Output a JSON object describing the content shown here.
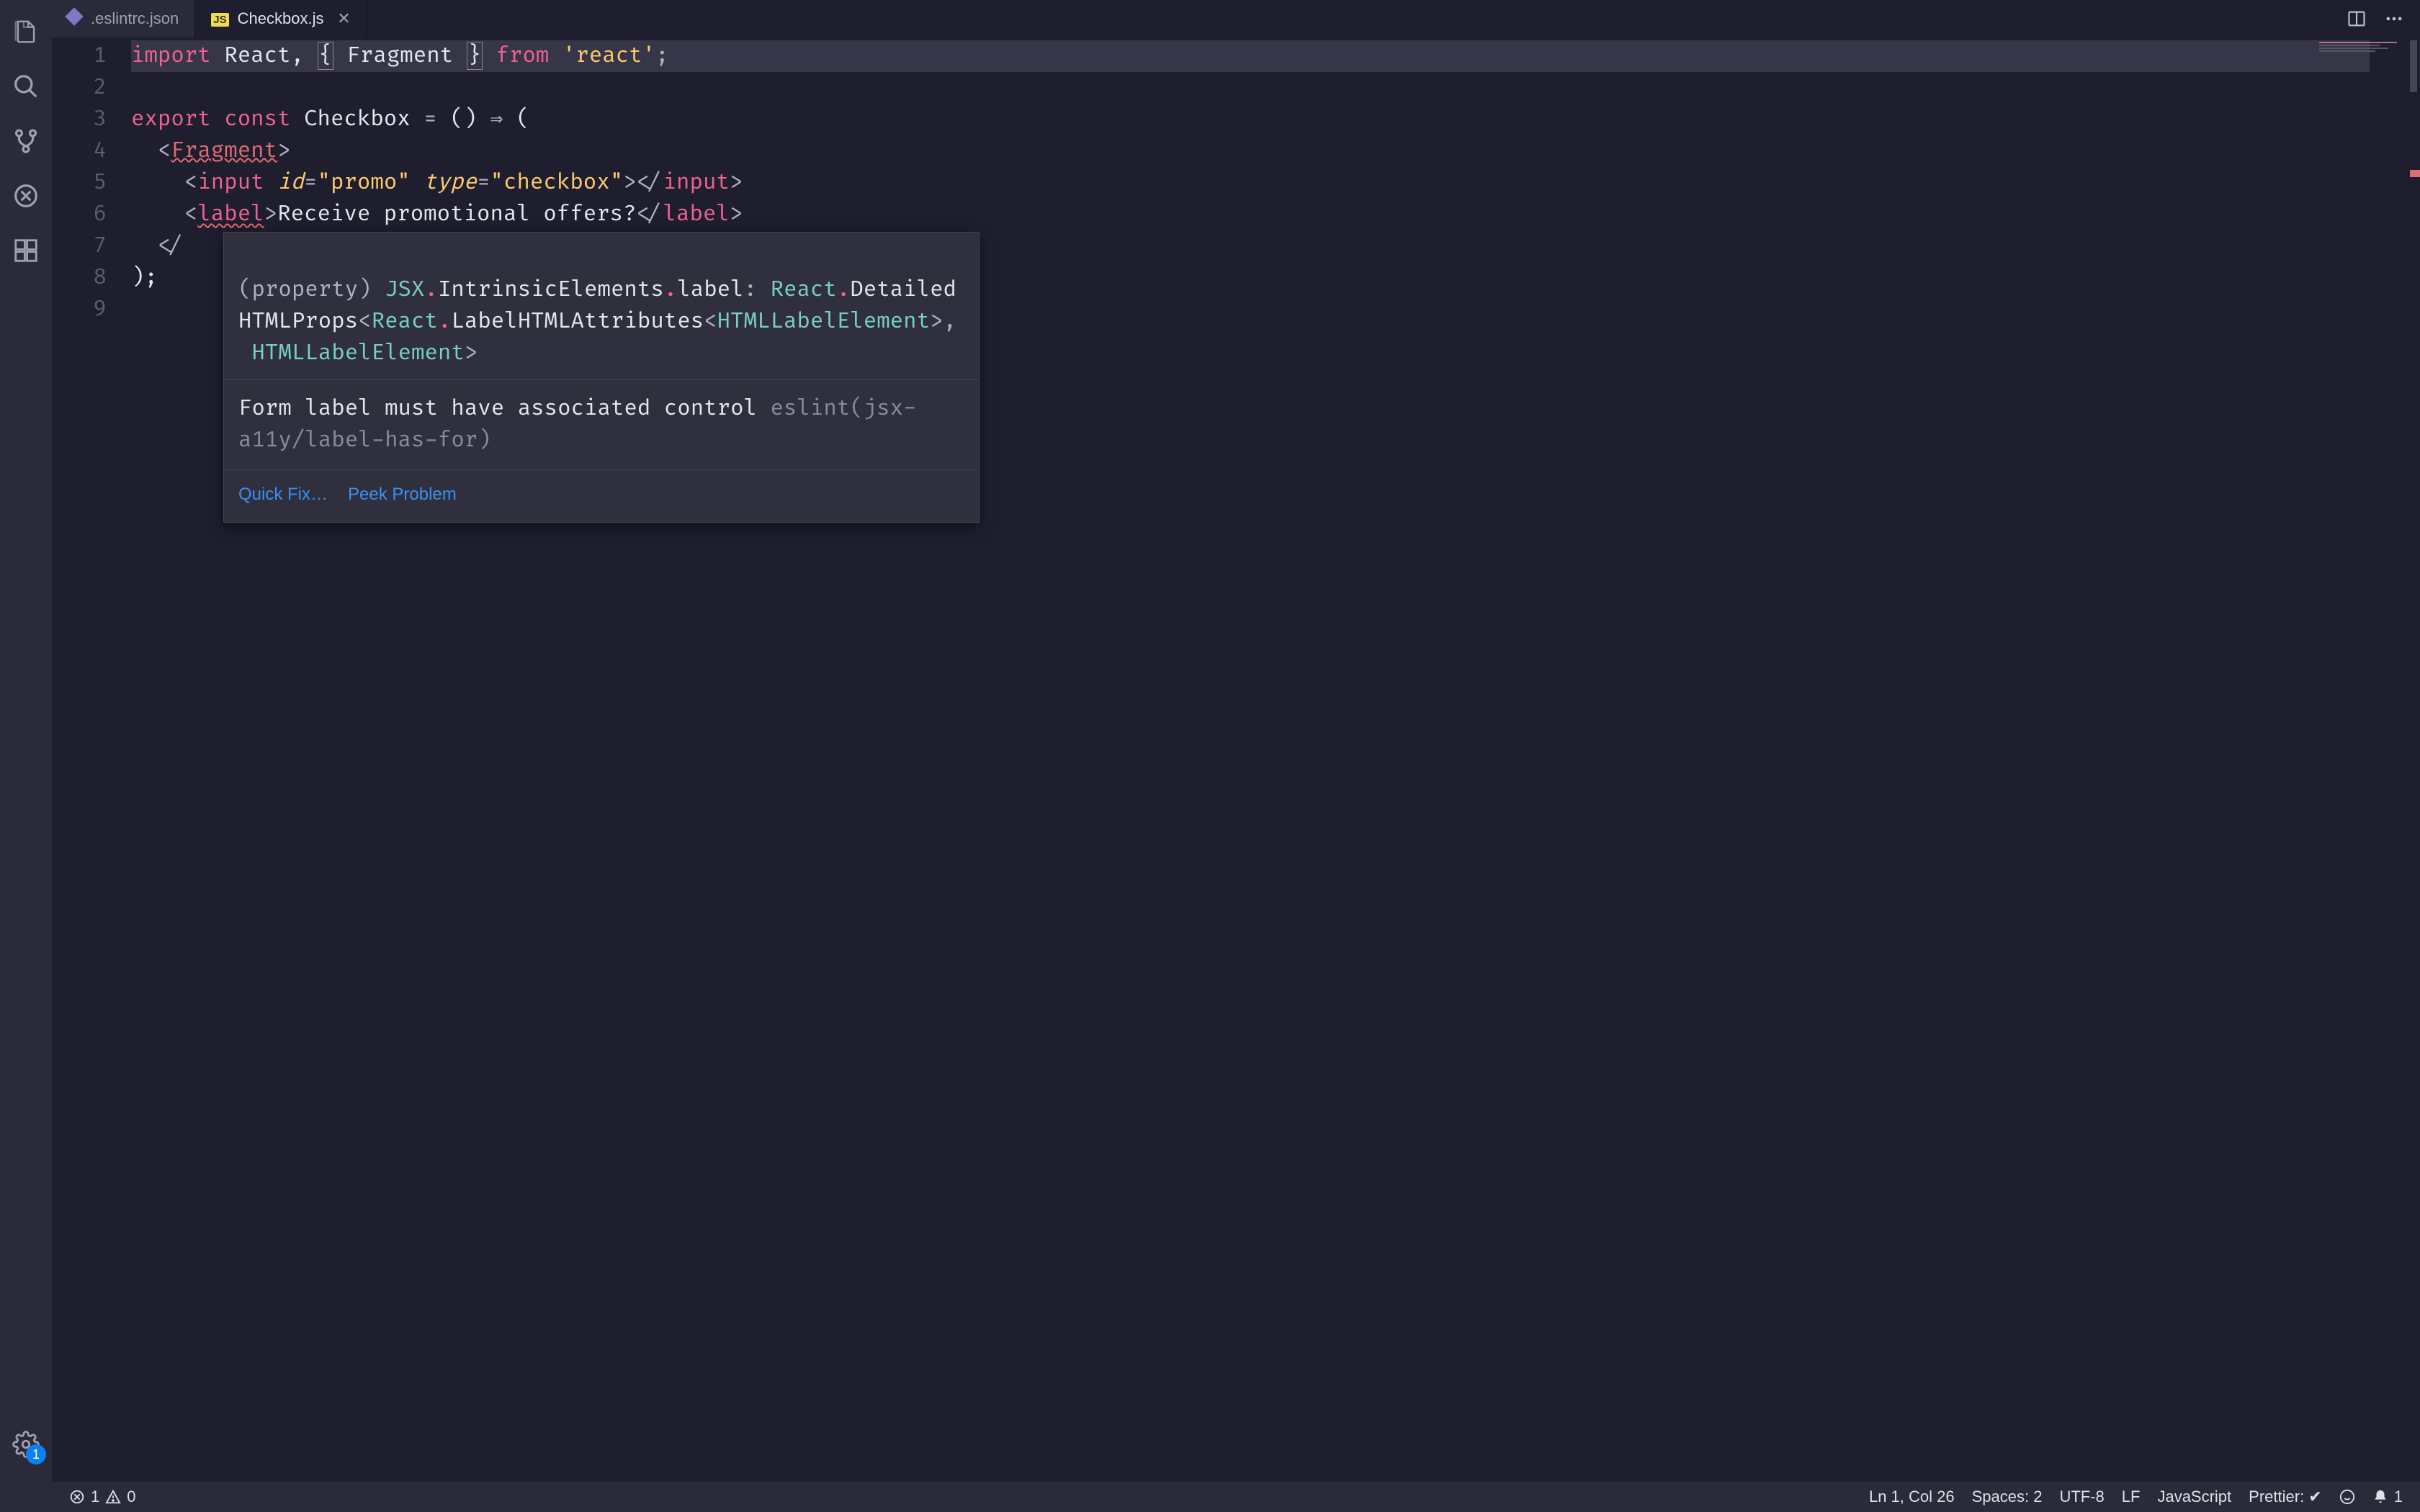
{
  "tabs": [
    {
      "label": ".eslintrc.json",
      "icon": "eslint",
      "active": false,
      "dirty": false
    },
    {
      "label": "Checkbox.js",
      "icon": "js",
      "active": true,
      "dirty": false
    }
  ],
  "gutter": {
    "lines": [
      "1",
      "2",
      "3",
      "4",
      "5",
      "6",
      "7",
      "8",
      "9"
    ]
  },
  "code": {
    "l1": {
      "a": "import",
      "b": " React",
      "c": ", ",
      "d": "{",
      "e": " Fragment ",
      "f": "}",
      "g": " ",
      "h": "from",
      "i": " ",
      "j": "'react'",
      "k": ";"
    },
    "l3": {
      "a": "export",
      "b": " ",
      "c": "const",
      "d": " Checkbox ",
      "e": "=",
      "f": " () ",
      "g": "⇒",
      "h": " ("
    },
    "l4": {
      "a": "<",
      "b": "Fragment",
      "c": ">"
    },
    "l5": {
      "a": "<",
      "b": "input",
      "c": " ",
      "d": "id",
      "e": "=",
      "f": "\"promo\"",
      "g": " ",
      "h": "type",
      "i": "=",
      "j": "\"checkbox\"",
      "k": ">",
      "l": "</",
      "m": "input",
      "n": ">"
    },
    "l6": {
      "a": "<",
      "b": "label",
      "c": ">",
      "d": "Receive promotional offers?",
      "e": "</",
      "f": "label",
      "g": ">"
    },
    "l7": {
      "a": "</"
    },
    "l8": {
      "a": ");"
    }
  },
  "hover": {
    "sig": {
      "p1": "(property) ",
      "p2": "JSX",
      "p3": ".",
      "p4": "IntrinsicElements",
      "p5": ".",
      "p6": "label",
      "p7": ": ",
      "p8": "React",
      "p9": ".",
      "p10": "Detailed",
      "q1": "HTMLProps",
      "q2": "<",
      "q3": "React",
      "q4": ".",
      "q5": "LabelHTMLAttributes",
      "q6": "<",
      "q7": "HTMLLabelElement",
      "q8": ">",
      "q9": ",",
      "r1": " HTMLLabelElement",
      "r2": ">"
    },
    "msg": "Form label must have associated control ",
    "rule": "eslint(jsx-a11y/label-has-for)",
    "action_quickfix": "Quick Fix…",
    "action_peek": "Peek Problem"
  },
  "status": {
    "errors": "1",
    "warnings": "0",
    "cursor": "Ln 1, Col 26",
    "spaces": "Spaces: 2",
    "encoding": "UTF-8",
    "eol": "LF",
    "language": "JavaScript",
    "prettier": "Prettier: ✔",
    "bell": "1"
  },
  "settings_badge": "1",
  "colors": {
    "bg": "#1e1e2e",
    "activity_bg": "#2a2a3a",
    "accent_blue": "#0d80f2",
    "error": "#e06c75"
  }
}
